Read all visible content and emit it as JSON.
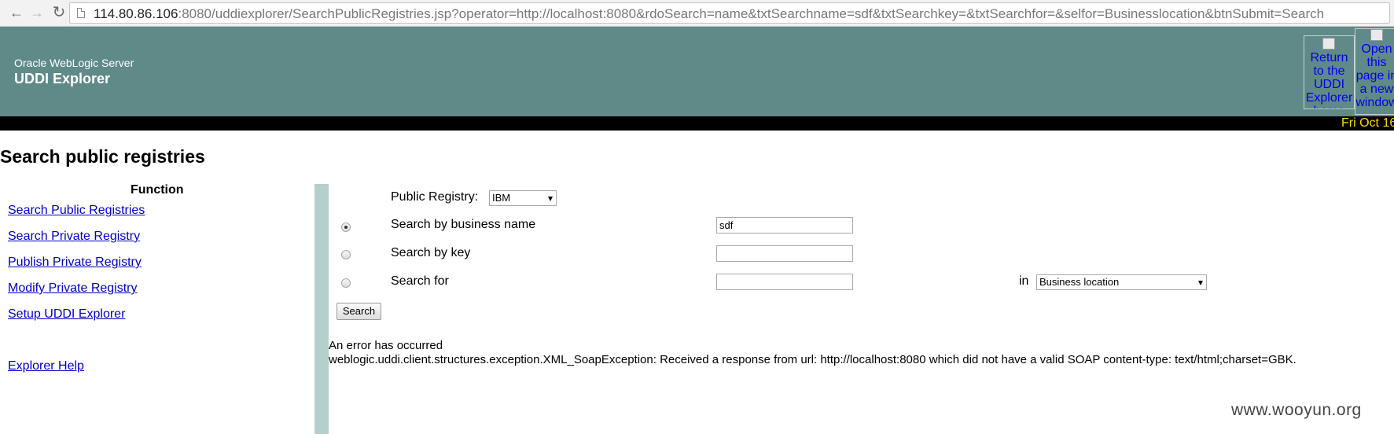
{
  "browser": {
    "url_host": "114.80.86.106",
    "url_rest": ":8080/uddiexplorer/SearchPublicRegistries.jsp?operator=http://localhost:8080&rdoSearch=name&txtSearchname=sdf&txtSearchkey=&txtSearchfor=&selfor=Businesslocation&btnSubmit=Search"
  },
  "header": {
    "subtitle": "Oracle WebLogic Server",
    "title": "UDDI Explorer",
    "return_img_alt": "Return to the UDDI Explorer home",
    "open_img_alt": "Open this page in a new window",
    "date": "Fri Oct 16"
  },
  "page": {
    "title": "Search public registries"
  },
  "function_menu": {
    "heading": "Function",
    "links": [
      "Search Public Registries",
      "Search Private Registry",
      "Publish Private Registry",
      "Modify Private Registry",
      "Setup UDDI Explorer"
    ],
    "help": "Explorer Help"
  },
  "form": {
    "registry_label": "Public Registry:",
    "registry_value": "IBM",
    "by_name_label": "Search by business name",
    "by_name_value": "sdf",
    "by_key_label": "Search by key",
    "by_key_value": "",
    "search_for_label": "Search for",
    "search_for_value": "",
    "in_label": "in",
    "in_value": "Business location",
    "selected_option": "Search by business name",
    "submit_label": "Search"
  },
  "error": {
    "heading": "An error has occurred",
    "message": "weblogic.uddi.client.structures.exception.XML_SoapException: Received a response from url: http://localhost:8080 which did not have a valid SOAP content-type: text/html;charset=GBK."
  },
  "watermark": "www.wooyun.org",
  "colors": {
    "header_bg": "#5f8a88",
    "date_text": "#ffd700",
    "separator": "#b5cfcb",
    "link": "#0000cc"
  }
}
